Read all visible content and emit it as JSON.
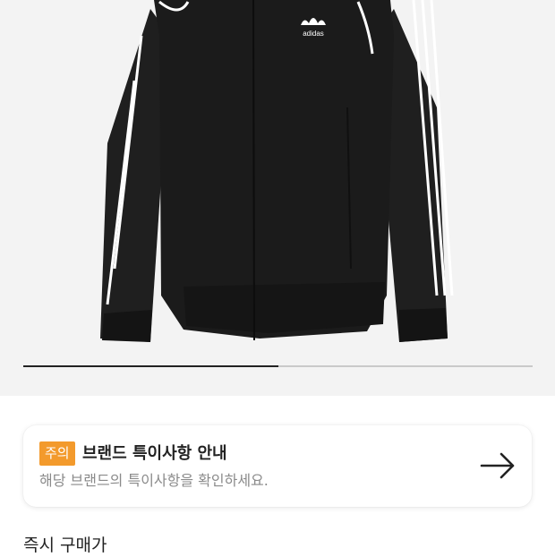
{
  "product": {
    "brand_logo_text": "adidas",
    "image_carousel": {
      "progress": 0.5
    }
  },
  "notice": {
    "tag": "주의",
    "title": "브랜드 특이사항 안내",
    "description": "해당 브랜드의 특이사항을 확인하세요.",
    "arrow_icon": "arrow-right-icon"
  },
  "section": {
    "title": "즉시 구매가"
  },
  "colors": {
    "tag_orange": "#f39a2c",
    "jacket_black": "#1b1b1b",
    "background_gray": "#f3f3f3"
  }
}
